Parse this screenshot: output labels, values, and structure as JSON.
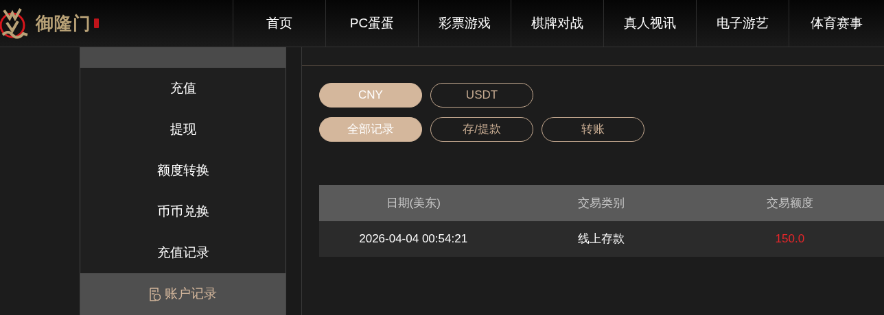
{
  "logo": {
    "text": "御隆门"
  },
  "nav": [
    {
      "label": "首页"
    },
    {
      "label": "PC蛋蛋"
    },
    {
      "label": "彩票游戏"
    },
    {
      "label": "棋牌对战"
    },
    {
      "label": "真人视讯"
    },
    {
      "label": "电子游艺"
    },
    {
      "label": "体育赛事"
    }
  ],
  "sidebar": {
    "items": [
      {
        "label": "充值",
        "selected": false
      },
      {
        "label": "提现",
        "selected": false
      },
      {
        "label": "额度转换",
        "selected": false
      },
      {
        "label": "币币兑换",
        "selected": false
      },
      {
        "label": "充值记录",
        "selected": false
      }
    ],
    "section": {
      "label": "账户记录",
      "selected": true
    }
  },
  "currency_tabs": [
    {
      "label": "CNY",
      "selected": true
    },
    {
      "label": "USDT",
      "selected": false
    }
  ],
  "record_tabs": [
    {
      "label": "全部记录",
      "selected": true
    },
    {
      "label": "存/提款",
      "selected": false
    },
    {
      "label": "转账",
      "selected": false
    }
  ],
  "table": {
    "columns": [
      "日期(美东)",
      "交易类别",
      "交易额度"
    ],
    "rows": [
      {
        "date": "2026-04-04 00:54:21",
        "type": "线上存款",
        "amount": "150.0"
      }
    ]
  }
}
